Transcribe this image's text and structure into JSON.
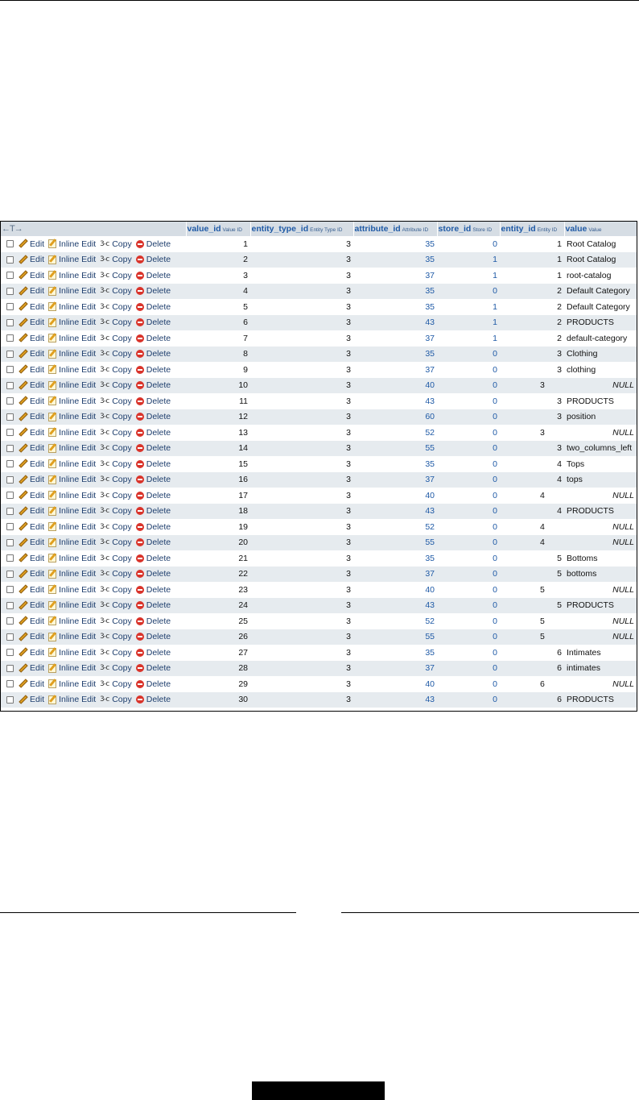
{
  "header": {
    "arrows": "←T→",
    "columns": [
      {
        "name": "value_id",
        "comment": "Value ID"
      },
      {
        "name": "entity_type_id",
        "comment": "Entity Type ID"
      },
      {
        "name": "attribute_id",
        "comment": "Attribute ID"
      },
      {
        "name": "store_id",
        "comment": "Store ID"
      },
      {
        "name": "entity_id",
        "comment": "Entity ID"
      },
      {
        "name": "value",
        "comment": "Value"
      }
    ]
  },
  "actions": {
    "edit": "Edit",
    "inline_edit": "Inline Edit",
    "copy": "Copy",
    "delete": "Delete"
  },
  "rows": [
    {
      "value_id": "1",
      "entity_type_id": "3",
      "attribute_id": "35",
      "store_id": "0",
      "entity_id": "1",
      "value": "Root Catalog"
    },
    {
      "value_id": "2",
      "entity_type_id": "3",
      "attribute_id": "35",
      "store_id": "1",
      "entity_id": "1",
      "value": "Root Catalog"
    },
    {
      "value_id": "3",
      "entity_type_id": "3",
      "attribute_id": "37",
      "store_id": "1",
      "entity_id": "1",
      "value": "root-catalog"
    },
    {
      "value_id": "4",
      "entity_type_id": "3",
      "attribute_id": "35",
      "store_id": "0",
      "entity_id": "2",
      "value": "Default Category"
    },
    {
      "value_id": "5",
      "entity_type_id": "3",
      "attribute_id": "35",
      "store_id": "1",
      "entity_id": "2",
      "value": "Default Category"
    },
    {
      "value_id": "6",
      "entity_type_id": "3",
      "attribute_id": "43",
      "store_id": "1",
      "entity_id": "2",
      "value": "PRODUCTS"
    },
    {
      "value_id": "7",
      "entity_type_id": "3",
      "attribute_id": "37",
      "store_id": "1",
      "entity_id": "2",
      "value": "default-category"
    },
    {
      "value_id": "8",
      "entity_type_id": "3",
      "attribute_id": "35",
      "store_id": "0",
      "entity_id": "3",
      "value": "Clothing"
    },
    {
      "value_id": "9",
      "entity_type_id": "3",
      "attribute_id": "37",
      "store_id": "0",
      "entity_id": "3",
      "value": "clothing"
    },
    {
      "value_id": "10",
      "entity_type_id": "3",
      "attribute_id": "40",
      "store_id": "0",
      "entity_id": "3",
      "value": "NULL"
    },
    {
      "value_id": "11",
      "entity_type_id": "3",
      "attribute_id": "43",
      "store_id": "0",
      "entity_id": "3",
      "value": "PRODUCTS"
    },
    {
      "value_id": "12",
      "entity_type_id": "3",
      "attribute_id": "60",
      "store_id": "0",
      "entity_id": "3",
      "value": "position"
    },
    {
      "value_id": "13",
      "entity_type_id": "3",
      "attribute_id": "52",
      "store_id": "0",
      "entity_id": "3",
      "value": "NULL"
    },
    {
      "value_id": "14",
      "entity_type_id": "3",
      "attribute_id": "55",
      "store_id": "0",
      "entity_id": "3",
      "value": "two_columns_left"
    },
    {
      "value_id": "15",
      "entity_type_id": "3",
      "attribute_id": "35",
      "store_id": "0",
      "entity_id": "4",
      "value": "Tops"
    },
    {
      "value_id": "16",
      "entity_type_id": "3",
      "attribute_id": "37",
      "store_id": "0",
      "entity_id": "4",
      "value": "tops"
    },
    {
      "value_id": "17",
      "entity_type_id": "3",
      "attribute_id": "40",
      "store_id": "0",
      "entity_id": "4",
      "value": "NULL"
    },
    {
      "value_id": "18",
      "entity_type_id": "3",
      "attribute_id": "43",
      "store_id": "0",
      "entity_id": "4",
      "value": "PRODUCTS"
    },
    {
      "value_id": "19",
      "entity_type_id": "3",
      "attribute_id": "52",
      "store_id": "0",
      "entity_id": "4",
      "value": "NULL"
    },
    {
      "value_id": "20",
      "entity_type_id": "3",
      "attribute_id": "55",
      "store_id": "0",
      "entity_id": "4",
      "value": "NULL"
    },
    {
      "value_id": "21",
      "entity_type_id": "3",
      "attribute_id": "35",
      "store_id": "0",
      "entity_id": "5",
      "value": "Bottoms"
    },
    {
      "value_id": "22",
      "entity_type_id": "3",
      "attribute_id": "37",
      "store_id": "0",
      "entity_id": "5",
      "value": "bottoms"
    },
    {
      "value_id": "23",
      "entity_type_id": "3",
      "attribute_id": "40",
      "store_id": "0",
      "entity_id": "5",
      "value": "NULL"
    },
    {
      "value_id": "24",
      "entity_type_id": "3",
      "attribute_id": "43",
      "store_id": "0",
      "entity_id": "5",
      "value": "PRODUCTS"
    },
    {
      "value_id": "25",
      "entity_type_id": "3",
      "attribute_id": "52",
      "store_id": "0",
      "entity_id": "5",
      "value": "NULL"
    },
    {
      "value_id": "26",
      "entity_type_id": "3",
      "attribute_id": "55",
      "store_id": "0",
      "entity_id": "5",
      "value": "NULL"
    },
    {
      "value_id": "27",
      "entity_type_id": "3",
      "attribute_id": "35",
      "store_id": "0",
      "entity_id": "6",
      "value": "Intimates"
    },
    {
      "value_id": "28",
      "entity_type_id": "3",
      "attribute_id": "37",
      "store_id": "0",
      "entity_id": "6",
      "value": "intimates"
    },
    {
      "value_id": "29",
      "entity_type_id": "3",
      "attribute_id": "40",
      "store_id": "0",
      "entity_id": "6",
      "value": "NULL"
    },
    {
      "value_id": "30",
      "entity_type_id": "3",
      "attribute_id": "43",
      "store_id": "0",
      "entity_id": "6",
      "value": "PRODUCTS"
    }
  ]
}
